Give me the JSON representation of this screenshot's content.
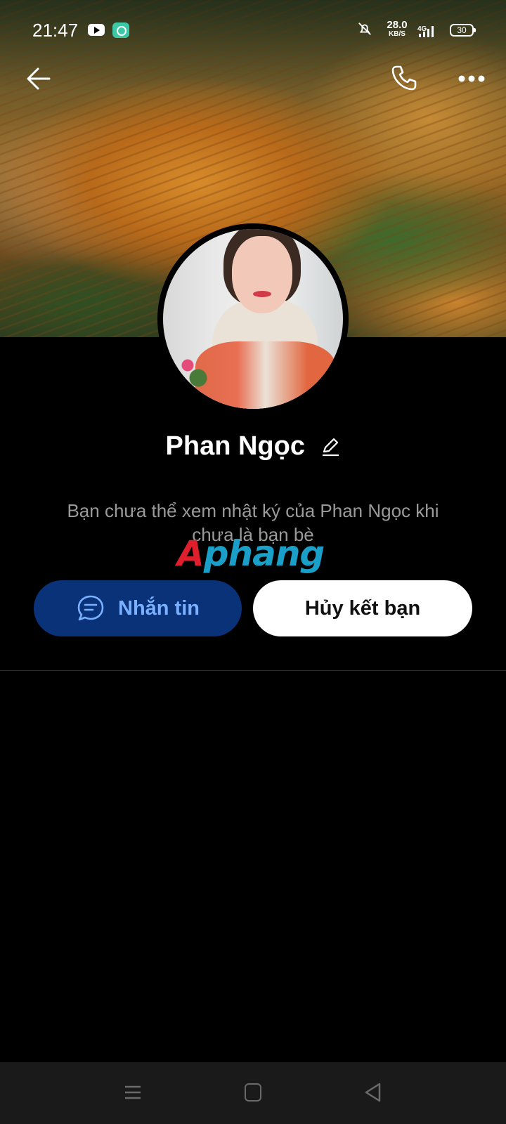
{
  "status_bar": {
    "time": "21:47",
    "speed_value": "28.0",
    "speed_unit": "KB/S",
    "network": "4G",
    "battery": "30"
  },
  "icons": {
    "back": "back-arrow-icon",
    "call": "phone-icon",
    "more": "more-icon",
    "edit": "pencil-icon",
    "message": "chat-bubble-icon"
  },
  "profile": {
    "name": "Phan Ngọc",
    "diary_notice": "Bạn chưa thể xem nhật ký của Phan Ngọc khi chưa là bạn bè"
  },
  "actions": {
    "message_label": "Nhắn tin",
    "unfriend_label": "Hủy kết bạn"
  },
  "watermark": {
    "first": "A",
    "rest": "phang"
  },
  "colors": {
    "message_button_bg": "#0a3278",
    "message_button_text": "#79b0ff",
    "unfriend_button_bg": "#ffffff",
    "background": "#000000"
  }
}
